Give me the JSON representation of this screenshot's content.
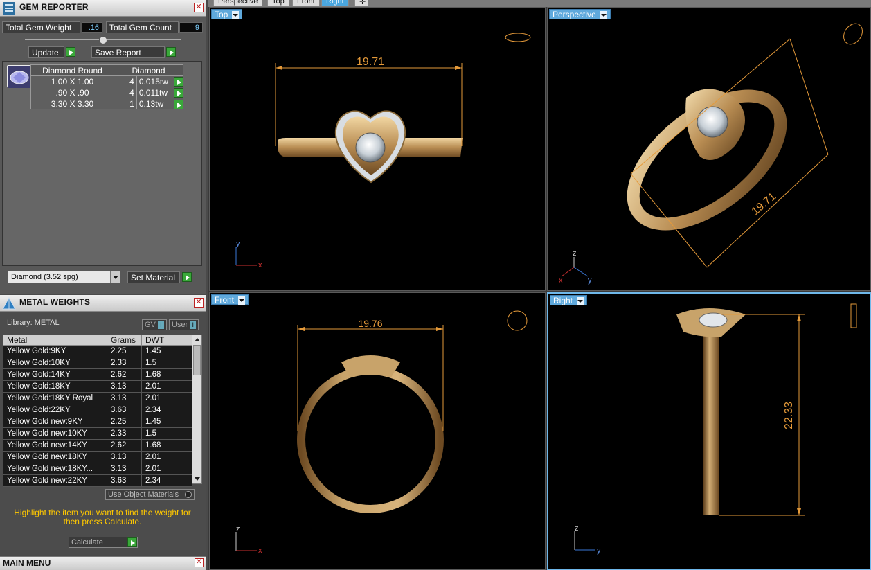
{
  "gem_reporter": {
    "title": "GEM REPORTER",
    "total_weight_label": "Total Gem Weight",
    "total_weight_value": ".16",
    "total_count_label": "Total Gem Count",
    "total_count_value": "9",
    "update_label": "Update",
    "save_report_label": "Save Report",
    "columns": [
      "Diamond Round",
      "Diamond"
    ],
    "rows": [
      {
        "size": "1.00 X 1.00",
        "qty": "4",
        "weight": "0.015tw"
      },
      {
        "size": ".90 X .90",
        "qty": "4",
        "weight": "0.011tw"
      },
      {
        "size": "3.30 X 3.30",
        "qty": "1",
        "weight": "0.13tw"
      }
    ],
    "material_select": "Diamond      (3.52 spg)",
    "set_material_label": "Set Material"
  },
  "metal_weights": {
    "title": "METAL WEIGHTS",
    "library_label": "Library: METAL",
    "gv_label": "GV",
    "user_label": "User",
    "toggle_icon": "I",
    "columns": [
      "Metal",
      "Grams",
      "DWT"
    ],
    "rows": [
      {
        "metal": "Yellow Gold:9KY",
        "grams": "2.25",
        "dwt": "1.45"
      },
      {
        "metal": "Yellow Gold:10KY",
        "grams": "2.33",
        "dwt": "1.5"
      },
      {
        "metal": "Yellow Gold:14KY",
        "grams": "2.62",
        "dwt": "1.68"
      },
      {
        "metal": "Yellow Gold:18KY",
        "grams": "3.13",
        "dwt": "2.01"
      },
      {
        "metal": "Yellow Gold:18KY Royal",
        "grams": "3.13",
        "dwt": "2.01"
      },
      {
        "metal": "Yellow Gold:22KY",
        "grams": "3.63",
        "dwt": "2.34"
      },
      {
        "metal": "Yellow Gold new:9KY",
        "grams": "2.25",
        "dwt": "1.45"
      },
      {
        "metal": "Yellow Gold new:10KY",
        "grams": "2.33",
        "dwt": "1.5"
      },
      {
        "metal": "Yellow Gold new:14KY",
        "grams": "2.62",
        "dwt": "1.68"
      },
      {
        "metal": "Yellow Gold new:18KY",
        "grams": "3.13",
        "dwt": "2.01"
      },
      {
        "metal": "Yellow Gold new:18KY...",
        "grams": "3.13",
        "dwt": "2.01"
      },
      {
        "metal": "Yellow Gold new:22KY",
        "grams": "3.63",
        "dwt": "2.34"
      }
    ],
    "use_object_materials": "Use Object Materials",
    "hint": "Highlight the item you want to find the weight for then press Calculate.",
    "calculate_label": "Calculate"
  },
  "main_menu": {
    "title": "MAIN MENU"
  },
  "top_tabs": [
    "Perspective",
    "Top",
    "Front",
    "Right"
  ],
  "viewports": {
    "top": {
      "label": "Top",
      "dimension": "19.71",
      "axis_a": "y",
      "axis_b": "x"
    },
    "perspective": {
      "label": "Perspective",
      "dimension": "19.71",
      "axis_x": "x",
      "axis_y": "y",
      "axis_z": "z"
    },
    "front": {
      "label": "Front",
      "dimension": "19.76",
      "axis_a": "z",
      "axis_b": "x"
    },
    "right": {
      "label": "Right",
      "dimension": "22.33",
      "axis_a": "z",
      "axis_b": "y"
    }
  },
  "colors": {
    "accent": "#5fa9dc",
    "gold": "#c8a36a",
    "dimension": "#e59a3a",
    "hint": "#ffc800",
    "go_button": "#3aa83a"
  }
}
